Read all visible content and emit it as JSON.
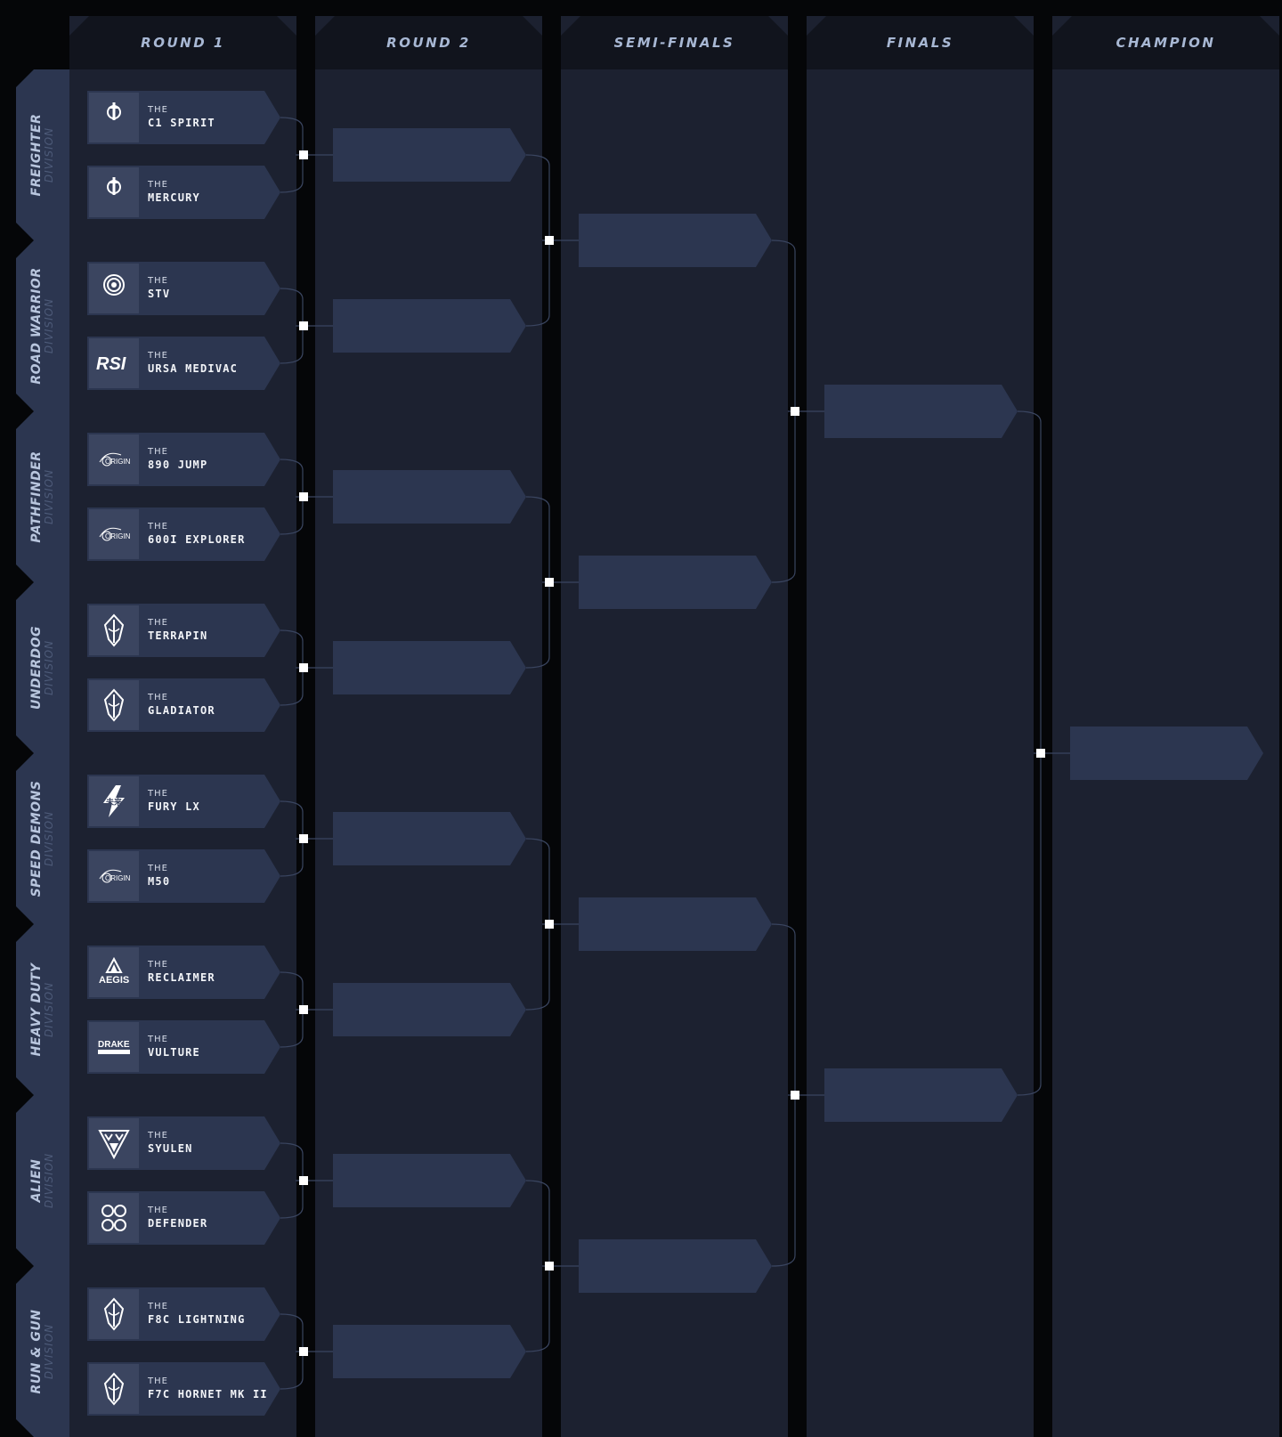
{
  "columns": [
    {
      "title": "ROUND 1"
    },
    {
      "title": "ROUND 2"
    },
    {
      "title": "SEMI-FINALS"
    },
    {
      "title": "FINALS"
    },
    {
      "title": "CHAMPION"
    }
  ],
  "divisions": [
    {
      "name": "FREIGHTER",
      "sub": "DIVISION"
    },
    {
      "name": "ROAD WARRIOR",
      "sub": "DIVISION"
    },
    {
      "name": "PATHFINDER",
      "sub": "DIVISION"
    },
    {
      "name": "UNDERDOG",
      "sub": "DIVISION"
    },
    {
      "name": "SPEED DEMONS",
      "sub": "DIVISION"
    },
    {
      "name": "HEAVY DUTY",
      "sub": "DIVISION"
    },
    {
      "name": "ALIEN",
      "sub": "DIVISION"
    },
    {
      "name": "RUN & GUN",
      "sub": "DIVISION"
    }
  ],
  "teams": [
    {
      "the": "THE",
      "name": "C1 SPIRIT",
      "logo": "CRUSADER",
      "icon": "crusader-logo"
    },
    {
      "the": "THE",
      "name": "MERCURY",
      "logo": "CRUSADER",
      "icon": "crusader-logo"
    },
    {
      "the": "THE",
      "name": "STV",
      "logo": "GREYCAT",
      "icon": "greycat-logo"
    },
    {
      "the": "THE",
      "name": "URSA MEDIVAC",
      "logo": "RSI",
      "icon": "rsi-logo"
    },
    {
      "the": "THE",
      "name": "890 JUMP",
      "logo": "ORIGIN",
      "icon": "origin-logo"
    },
    {
      "the": "THE",
      "name": "600I EXPLORER",
      "logo": "ORIGIN",
      "icon": "origin-logo"
    },
    {
      "the": "THE",
      "name": "TERRAPIN",
      "logo": "",
      "icon": "anvil-logo"
    },
    {
      "the": "THE",
      "name": "GLADIATOR",
      "logo": "",
      "icon": "anvil-logo"
    },
    {
      "the": "THE",
      "name": "FURY LX",
      "logo": "",
      "icon": "mirai-logo"
    },
    {
      "the": "THE",
      "name": "M50",
      "logo": "ORIGIN",
      "icon": "origin-logo"
    },
    {
      "the": "THE",
      "name": "RECLAIMER",
      "logo": "AEGIS",
      "icon": "aegis-logo"
    },
    {
      "the": "THE",
      "name": "VULTURE",
      "logo": "DRAKE",
      "icon": "drake-logo"
    },
    {
      "the": "THE",
      "name": "SYULEN",
      "logo": "",
      "icon": "gatac-logo"
    },
    {
      "the": "THE",
      "name": "DEFENDER",
      "logo": "",
      "icon": "banu-logo"
    },
    {
      "the": "THE",
      "name": "F8C LIGHTNING",
      "logo": "",
      "icon": "anvil-logo"
    },
    {
      "the": "THE",
      "name": "F7C HORNET MK II",
      "logo": "",
      "icon": "anvil-logo"
    }
  ],
  "colors": {
    "page_bg": "#050608",
    "column_bg": "#1c2130",
    "header_bg": "#11141d",
    "card_bg": "#2c3650",
    "logo_bg": "#3b4560",
    "title_text": "#a8b8d4",
    "connector": "#3a4560",
    "node": "#ffffff"
  }
}
